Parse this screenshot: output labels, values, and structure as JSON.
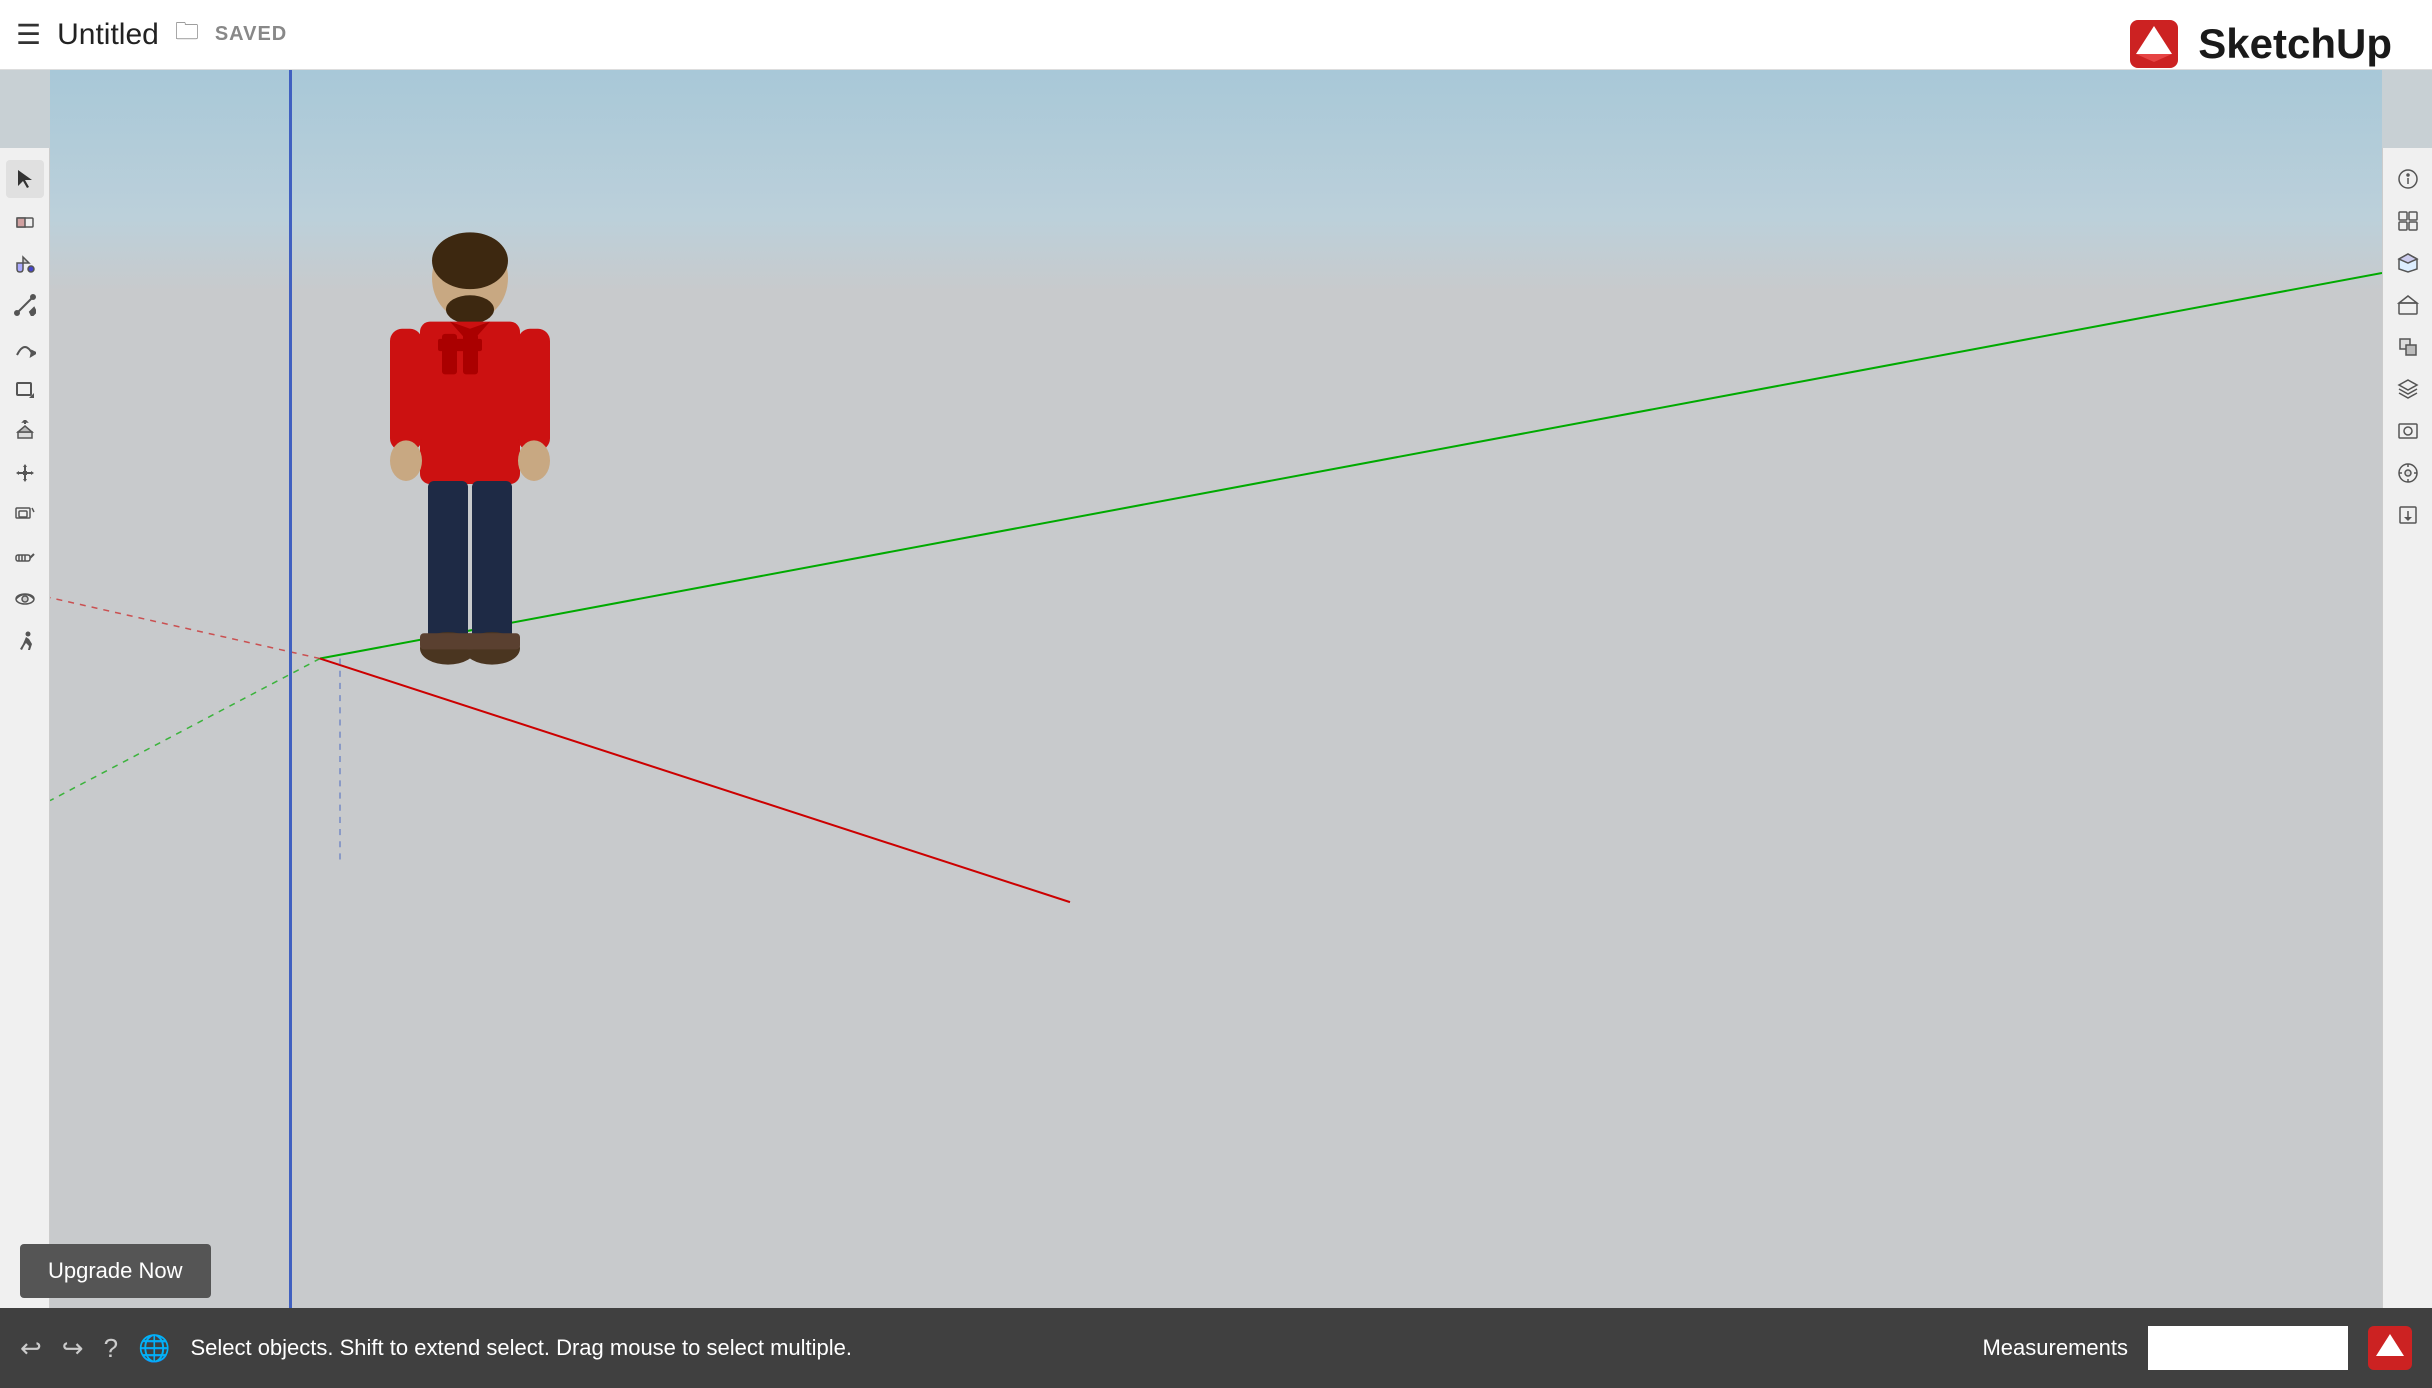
{
  "titlebar": {
    "hamburger": "☰",
    "title": "Untitled",
    "saved_badge": "SAVED"
  },
  "logo": {
    "text": "SketchUp"
  },
  "statusbar": {
    "status_text": "Select objects. Shift to extend select. Drag mouse to select multiple.",
    "measurements_label": "Measurements"
  },
  "upgrade_button": {
    "label": "Upgrade Now"
  },
  "left_toolbar": {
    "tools": [
      {
        "name": "select",
        "icon": "arrow",
        "label": "Select"
      },
      {
        "name": "eraser",
        "icon": "eraser",
        "label": "Eraser"
      },
      {
        "name": "paint-bucket",
        "icon": "paint",
        "label": "Paint Bucket"
      },
      {
        "name": "line",
        "icon": "line",
        "label": "Line"
      },
      {
        "name": "arc",
        "icon": "arc",
        "label": "Arc"
      },
      {
        "name": "rectangle",
        "icon": "rect",
        "label": "Rectangle"
      },
      {
        "name": "push-pull",
        "icon": "push",
        "label": "Push/Pull"
      },
      {
        "name": "move",
        "icon": "move",
        "label": "Move"
      },
      {
        "name": "offset",
        "icon": "offset",
        "label": "Offset"
      },
      {
        "name": "tape-measure",
        "icon": "tape",
        "label": "Tape Measure"
      },
      {
        "name": "orbit",
        "icon": "orbit",
        "label": "Orbit"
      },
      {
        "name": "walk",
        "icon": "walk",
        "label": "Walk"
      }
    ]
  },
  "right_toolbar": {
    "tools": [
      {
        "name": "model-info",
        "icon": "info"
      },
      {
        "name": "components",
        "icon": "components"
      },
      {
        "name": "materials",
        "icon": "materials"
      },
      {
        "name": "3d-warehouse",
        "icon": "warehouse"
      },
      {
        "name": "solid-tools",
        "icon": "solid"
      },
      {
        "name": "layers",
        "icon": "layers"
      },
      {
        "name": "scenes",
        "icon": "scenes"
      },
      {
        "name": "extensions",
        "icon": "extensions"
      },
      {
        "name": "import",
        "icon": "import"
      }
    ]
  },
  "colors": {
    "accent_red": "#cc0000",
    "axis_green": "#00aa00",
    "axis_red": "#cc0000",
    "axis_blue": "#4060c0",
    "sky_top": "#a8c8d8",
    "sky_bottom": "#c0d8e0",
    "ground": "#c8cacc"
  }
}
